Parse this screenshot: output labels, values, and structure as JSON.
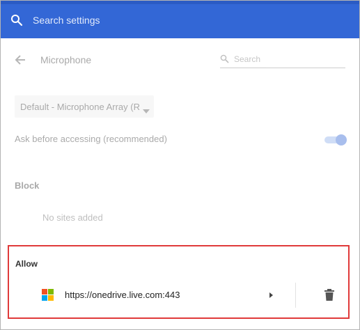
{
  "header": {
    "search_placeholder": "Search settings"
  },
  "subheader": {
    "title": "Microphone",
    "search_placeholder": "Search"
  },
  "microphone": {
    "device_selected": "Default - Microphone Array (Re",
    "ask_label": "Ask before accessing (recommended)",
    "ask_enabled": true
  },
  "block": {
    "label": "Block",
    "empty_text": "No sites added"
  },
  "allow": {
    "label": "Allow",
    "sites": [
      {
        "url": "https://onedrive.live.com:443",
        "icon": "microsoft-logo"
      }
    ]
  },
  "colors": {
    "header_bg": "#3367d6",
    "highlight_border": "#e03a3a",
    "toggle_on": "#3367d6"
  }
}
